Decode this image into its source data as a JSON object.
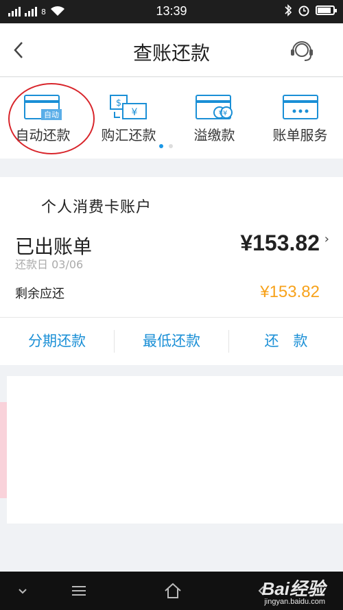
{
  "status_bar": {
    "time": "13:39",
    "sim_label": "8"
  },
  "nav": {
    "title": "查账还款"
  },
  "quick_actions": [
    {
      "label": "自动还款",
      "badge": "自动"
    },
    {
      "label": "购汇还款",
      "icon_text": "$ ¥"
    },
    {
      "label": "溢缴款",
      "icon_text": "¥¥"
    },
    {
      "label": "账单服务"
    }
  ],
  "pager": {
    "pages": 2,
    "current": 1
  },
  "account": {
    "name": "个人消费卡账户",
    "statement_label": "已出账单",
    "due_date": "还款日 03/06",
    "amount": "¥153.82",
    "remaining_label": "剩余应还",
    "remaining_amount": "¥153.82"
  },
  "actions": {
    "installment": "分期还款",
    "minimum": "最低还款",
    "repay": "还　款"
  },
  "watermark": {
    "brand": "Bai经验",
    "url": "jingyan.baidu.com"
  },
  "colors": {
    "accent": "#1a8fd6",
    "amount_orange": "#f7a21b",
    "annotation_red": "#d8252b"
  }
}
